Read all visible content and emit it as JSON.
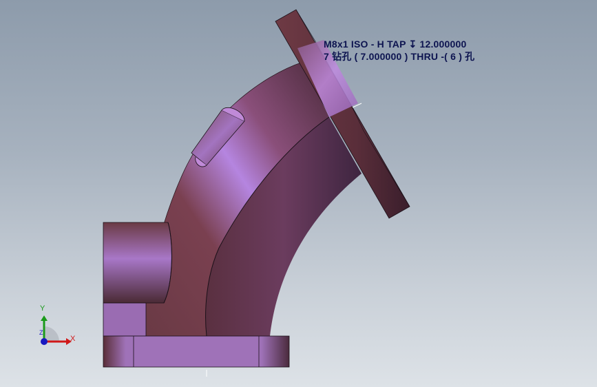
{
  "viewport": {
    "annotation": {
      "line1": "M8x1 ISO - H TAP ↧ 12.000000",
      "line2": "7 钻孔 ( 7.000000 )  THRU  -( 6 ) 孔"
    },
    "triad": {
      "x_label": "X",
      "y_label": "Y",
      "z_label": "Z"
    }
  },
  "colors": {
    "background_top": "#8d9bab",
    "background_bottom": "#dde2e7",
    "body_dark": "#4a2c36",
    "body_mid": "#7a3f48",
    "highlight": "#b07ad8",
    "flange_face": "#9a6bb0",
    "annotation_text": "#0d1450",
    "axis_x": "#d01818",
    "axis_y": "#1a9a1a",
    "axis_z": "#1818c0"
  }
}
